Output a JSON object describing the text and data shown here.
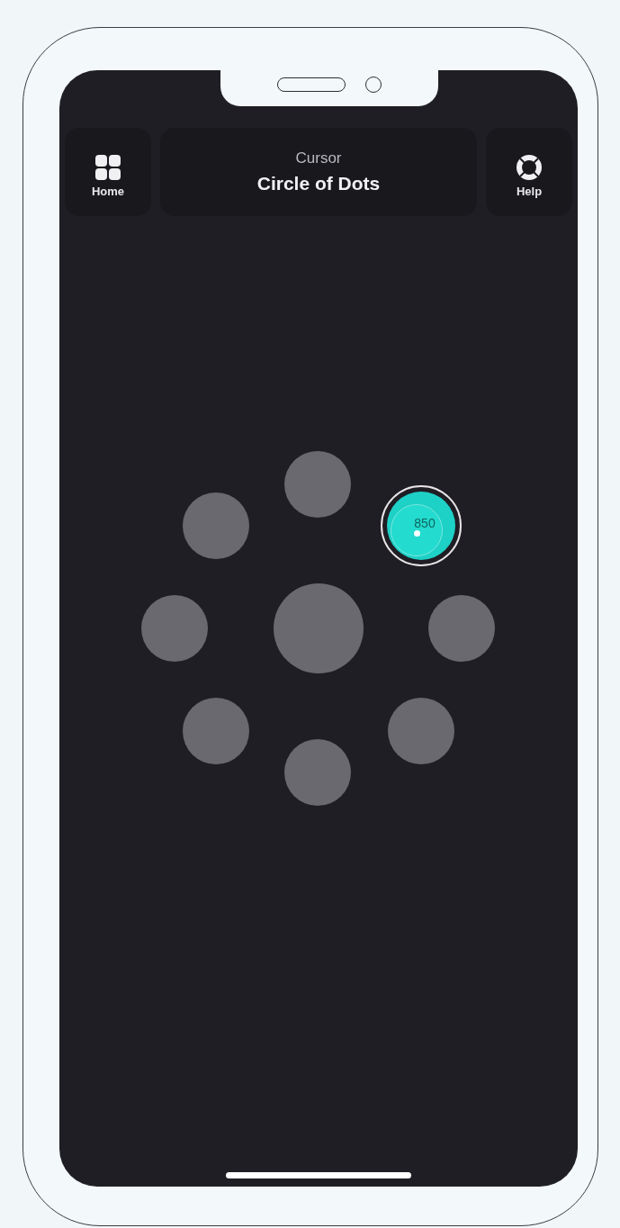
{
  "header": {
    "home": {
      "label": "Home"
    },
    "subtitle": "Cursor",
    "title": "Circle of Dots",
    "help": {
      "label": "Help"
    }
  },
  "dots": [
    {
      "selected": false
    },
    {
      "selected": false
    },
    {
      "selected": true,
      "value": "850"
    },
    {
      "selected": false
    },
    {
      "selected": false
    },
    {
      "selected": false
    },
    {
      "selected": false
    },
    {
      "selected": false
    },
    {
      "selected": false
    }
  ]
}
